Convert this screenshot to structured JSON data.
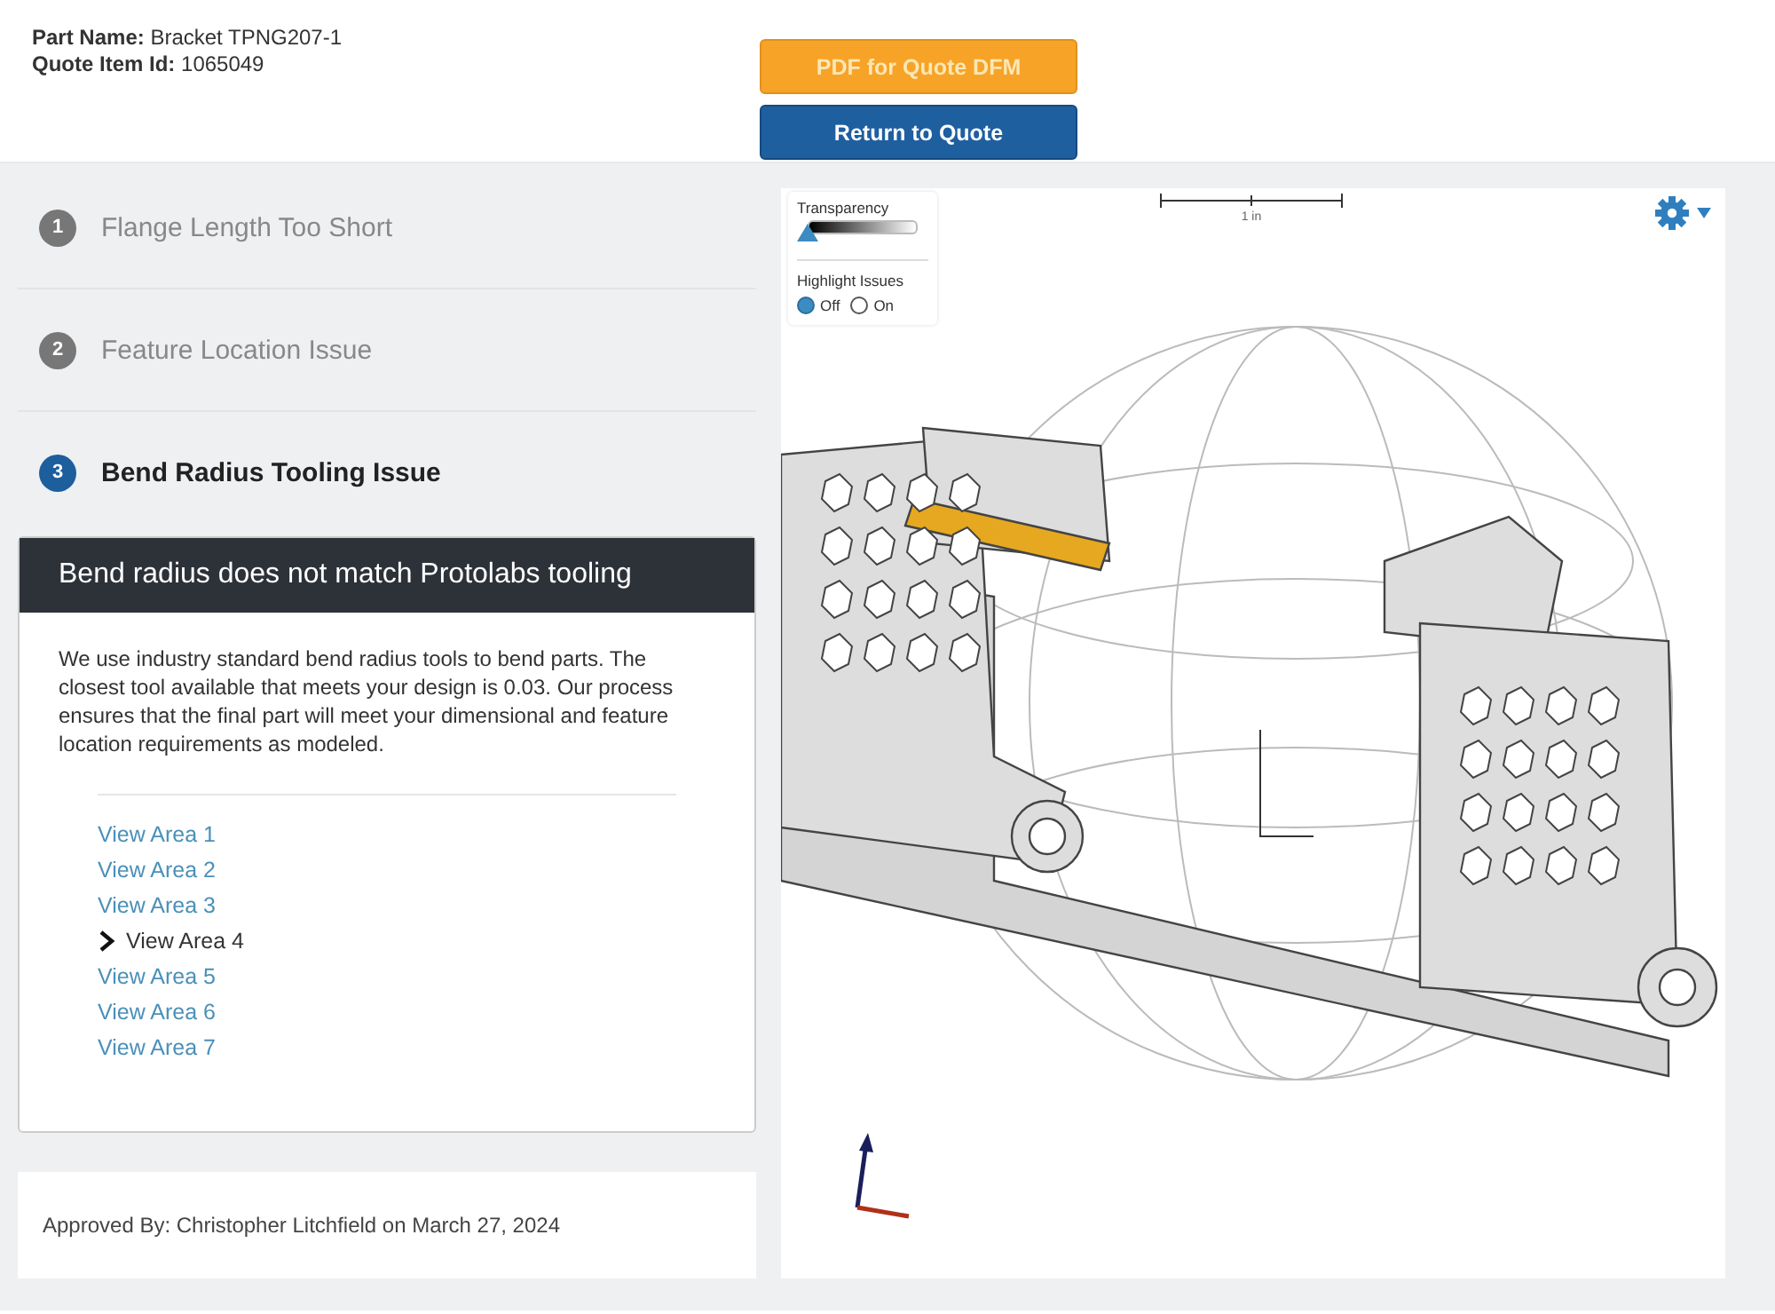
{
  "header": {
    "part_name_label": "Part Name:",
    "part_name": "Bracket TPNG207-1",
    "quote_item_label": "Quote Item Id:",
    "quote_item_id": "1065049"
  },
  "buttons": [
    {
      "label": "PDF for Quote DFM",
      "kind": "pdf"
    },
    {
      "label": "Return to Quote",
      "kind": "return"
    }
  ],
  "issues": [
    {
      "number": "1",
      "title": "Flange Length Too Short",
      "selected": false
    },
    {
      "number": "2",
      "title": "Feature Location Issue",
      "selected": false
    },
    {
      "number": "3",
      "title": "Bend Radius Tooling Issue",
      "selected": true
    }
  ],
  "issue_card": {
    "title": "Bend radius does not match Protolabs tooling",
    "description": "We use industry standard bend radius tools to bend parts. The closest tool available that meets your design is 0.03. Our process ensures that the final part will meet your dimensional and feature location requirements as modeled.",
    "areas": [
      {
        "label": "View Area 1",
        "selected": false
      },
      {
        "label": "View Area 2",
        "selected": false
      },
      {
        "label": "View Area 3",
        "selected": false
      },
      {
        "label": "View Area 4",
        "selected": true
      },
      {
        "label": "View Area 5",
        "selected": false
      },
      {
        "label": "View Area 6",
        "selected": false
      },
      {
        "label": "View Area 7",
        "selected": false
      }
    ]
  },
  "approval": "Approved By: Christopher Litchfield on March 27, 2024",
  "viewer": {
    "transparency": {
      "label": "Transparency",
      "level": 0
    },
    "highlight": {
      "label": "Highlight Issues",
      "options": [
        {
          "label": "Off",
          "selected": true
        },
        {
          "label": "On",
          "selected": false
        }
      ]
    },
    "scale_label": "1 in"
  }
}
